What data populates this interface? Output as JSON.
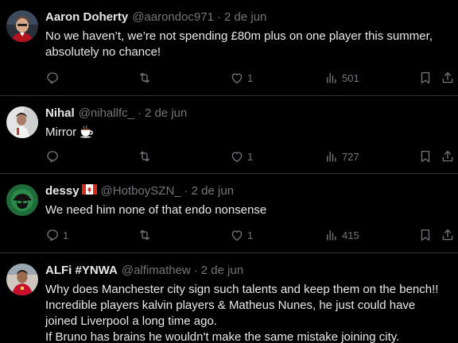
{
  "tweets": [
    {
      "name": "Aaron Doherty",
      "handle": "@aarondoc971",
      "separator": "·",
      "date": "2 de jun",
      "lines": [
        "No we haven’t, we’re not spending £80m plus on one player this summer,",
        "absolutely no chance!"
      ],
      "replies": "",
      "retweets": "",
      "likes": "1",
      "views": "501"
    },
    {
      "name": "Nihal",
      "handle": "@nihallfc_",
      "separator": "·",
      "date": "2 de jun",
      "lines": [
        "Mirror"
      ],
      "emoji": "coffee-emoji",
      "replies": "",
      "retweets": "",
      "likes": "1",
      "views": "727"
    },
    {
      "name": "dessy",
      "flag": "canada-flag-emoji",
      "handle": "@HotboySZN_",
      "separator": "·",
      "date": "2 de jun",
      "lines": [
        "We need him none of that endo nonsense"
      ],
      "replies": "1",
      "retweets": "",
      "likes": "1",
      "views": "415"
    },
    {
      "name": "ALFi #YNWA",
      "handle": "@alfimathew",
      "separator": "·",
      "date": "2 de jun",
      "lines": [
        "Why does Manchester city sign such talents and keep them on the bench!!",
        "Incredible players kalvin players & Matheus Nunes, he just could have",
        "joined Liverpool a long time ago.",
        "If Bruno has brains he wouldn't make the same mistake joining city."
      ]
    }
  ],
  "colors": {
    "background": "#000000",
    "text": "#e7e9ea",
    "muted": "#71767b",
    "divider": "#2f3336"
  },
  "icons": [
    "reply-icon",
    "retweet-icon",
    "like-icon",
    "views-icon",
    "bookmark-icon",
    "share-icon"
  ]
}
